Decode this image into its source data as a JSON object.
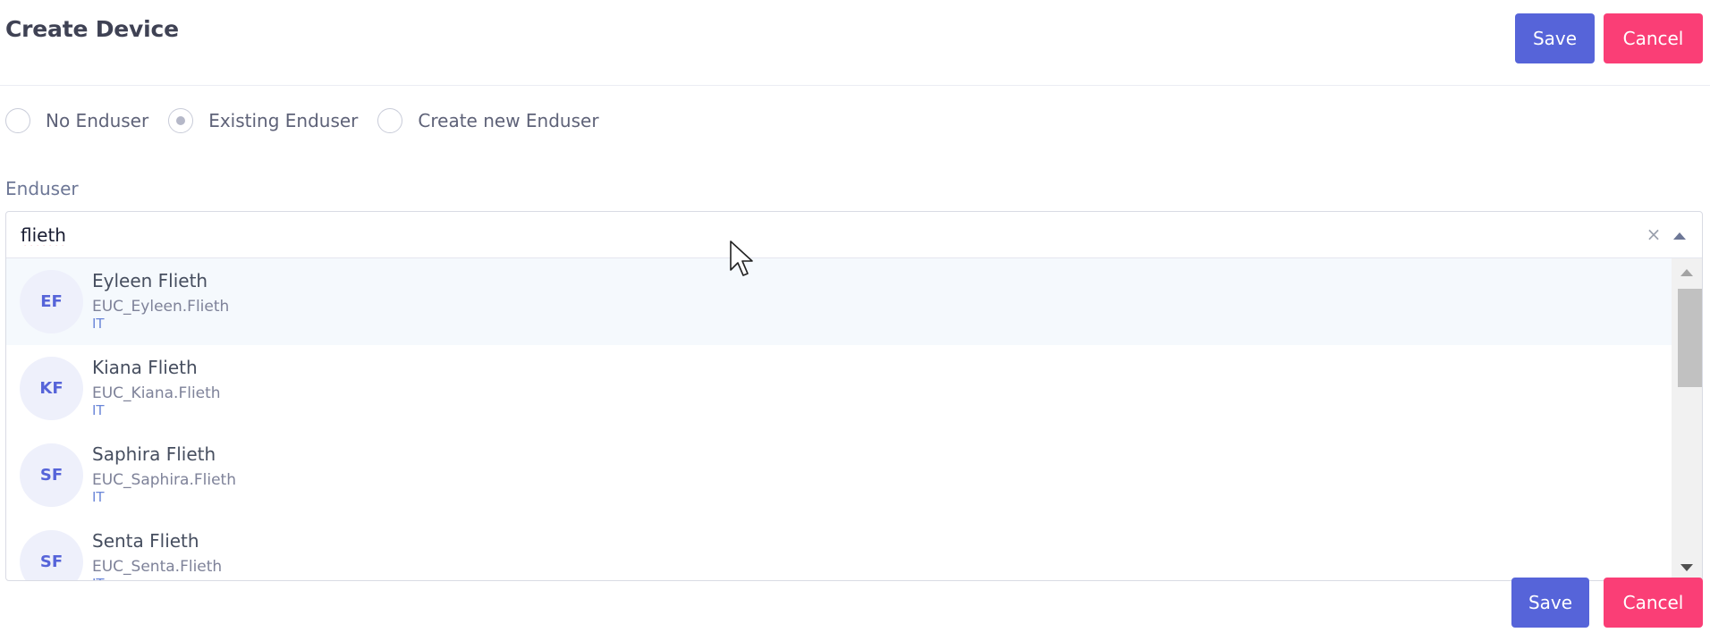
{
  "header": {
    "title": "Create Device",
    "save_label": "Save",
    "cancel_label": "Cancel"
  },
  "enduser_mode": {
    "options": [
      {
        "label": "No Enduser",
        "selected": false
      },
      {
        "label": "Existing Enduser",
        "selected": true
      },
      {
        "label": "Create new Enduser",
        "selected": false
      }
    ]
  },
  "enduser_field": {
    "label": "Enduser",
    "search_value": "flieth",
    "clear_icon": "×",
    "results": [
      {
        "initials": "EF",
        "name": "Eyleen Flieth",
        "username": "EUC_Eyleen.Flieth",
        "department": "IT",
        "highlighted": true
      },
      {
        "initials": "KF",
        "name": "Kiana Flieth",
        "username": "EUC_Kiana.Flieth",
        "department": "IT",
        "highlighted": false
      },
      {
        "initials": "SF",
        "name": "Saphira Flieth",
        "username": "EUC_Saphira.Flieth",
        "department": "IT",
        "highlighted": false
      },
      {
        "initials": "SF",
        "name": "Senta Flieth",
        "username": "EUC_Senta.Flieth",
        "department": "IT",
        "highlighted": false
      }
    ]
  },
  "footer": {
    "save_label": "Save",
    "cancel_label": "Cancel"
  },
  "colors": {
    "primary": "#5664d9",
    "danger": "#fa3e76",
    "highlight_row": "#f5f9fd",
    "avatar_bg": "#eef0fb"
  }
}
